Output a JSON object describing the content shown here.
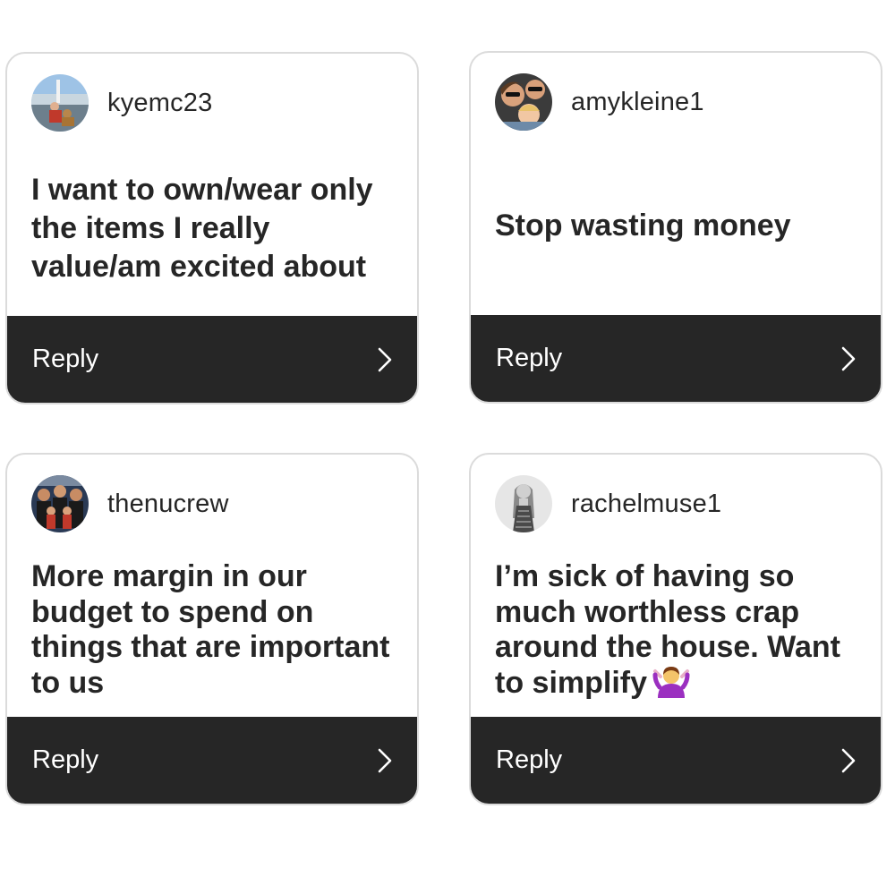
{
  "colors": {
    "card_border": "#dbdbdb",
    "reply_bar": "#262626",
    "text": "#262626",
    "reply_text": "#ffffff"
  },
  "cards": [
    {
      "username": "kyemc23",
      "message": "I want to own/wear only the items I really value/am excited about",
      "reply_label": "Reply",
      "avatar_icon": "user-photo-avatar"
    },
    {
      "username": "amykleine1",
      "message": "Stop wasting money",
      "reply_label": "Reply",
      "avatar_icon": "user-photo-avatar"
    },
    {
      "username": "thenucrew",
      "message": "More margin in our budget to spend on things that are important to us",
      "reply_label": "Reply",
      "avatar_icon": "user-photo-avatar"
    },
    {
      "username": "rachelmuse1",
      "message": "I’m sick of having so much worthless crap around the house. Want to simplify",
      "emoji": "🤷‍♀️",
      "reply_label": "Reply",
      "avatar_icon": "user-photo-avatar"
    }
  ]
}
